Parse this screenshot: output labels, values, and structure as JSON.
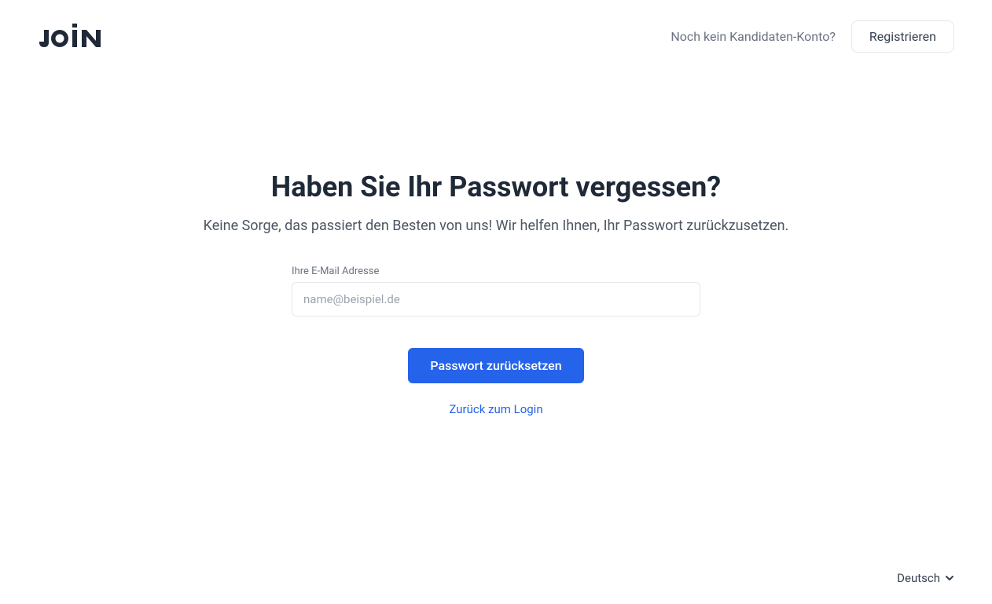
{
  "header": {
    "logo_text": "JOIN",
    "no_account_text": "Noch kein Kandidaten-Konto?",
    "register_label": "Registrieren"
  },
  "main": {
    "title": "Haben Sie Ihr Passwort vergessen?",
    "subtitle": "Keine Sorge, das passiert den Besten von uns! Wir helfen Ihnen, Ihr Passwort zurückzusetzen.",
    "email_label": "Ihre E-Mail Adresse",
    "email_placeholder": "name@beispiel.de",
    "submit_label": "Passwort zurücksetzen",
    "back_link_label": "Zurück zum Login"
  },
  "footer": {
    "language_label": "Deutsch"
  },
  "colors": {
    "primary": "#2563eb",
    "text_dark": "#1f2937",
    "text_muted": "#6b7280"
  }
}
